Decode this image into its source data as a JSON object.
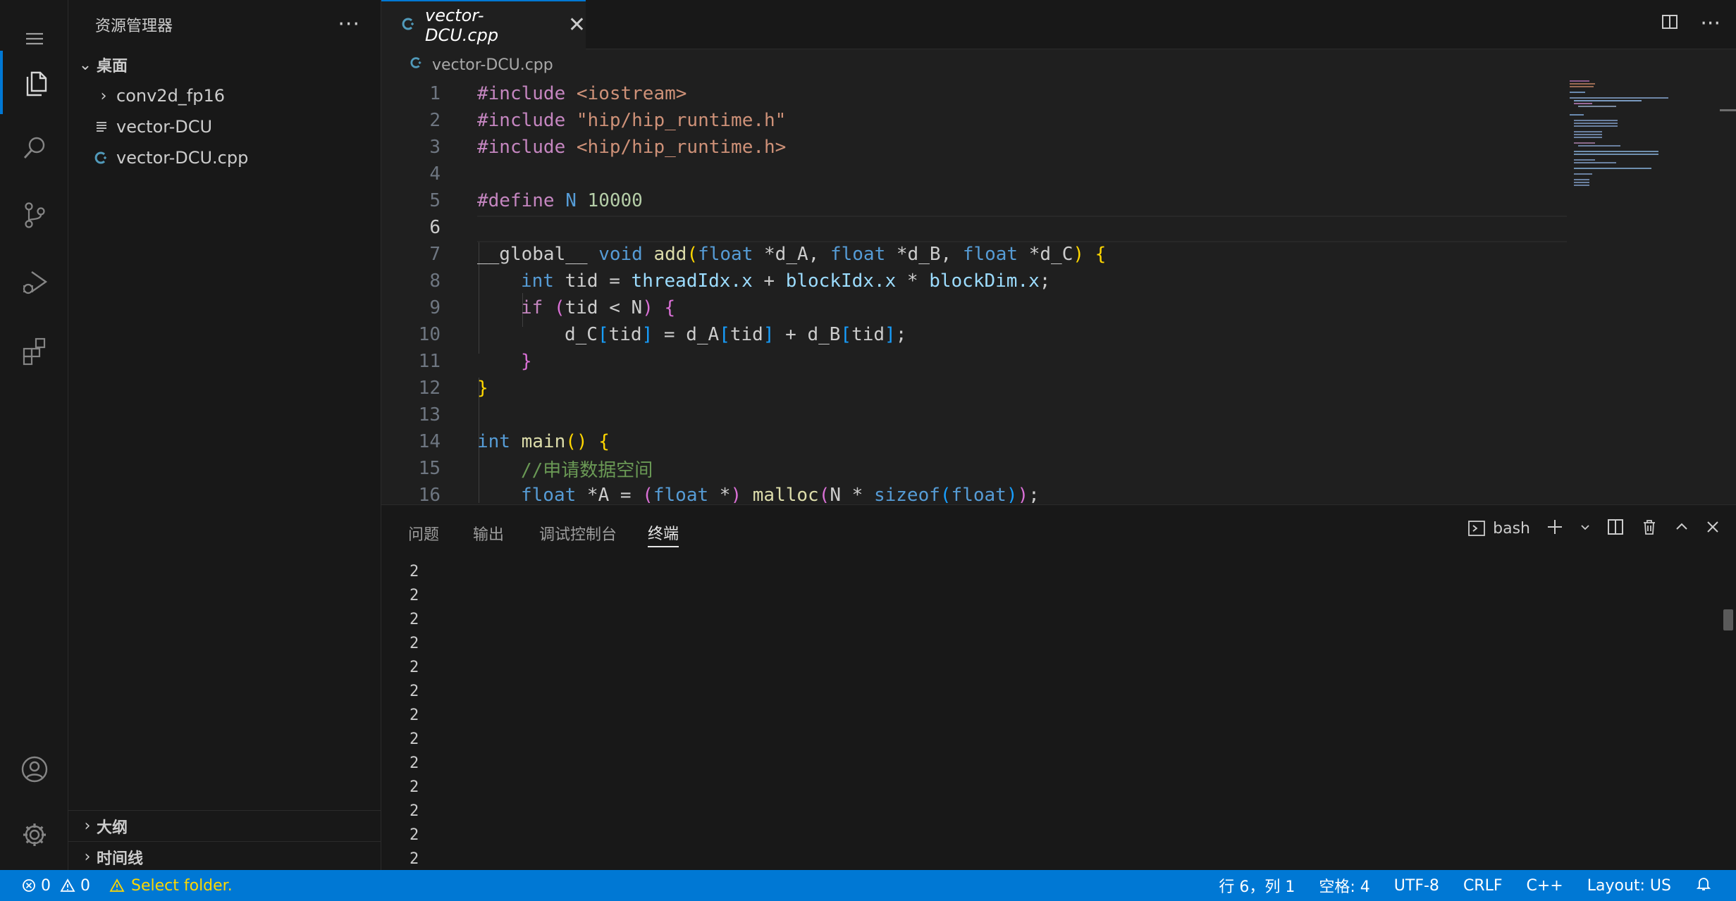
{
  "explorer": {
    "title": "资源管理器",
    "more_label": "···",
    "folder_name": "桌面",
    "items": [
      {
        "label": "conv2d_fp16",
        "kind": "folder"
      },
      {
        "label": "vector-DCU",
        "kind": "file"
      },
      {
        "label": "vector-DCU.cpp",
        "kind": "cpp"
      }
    ],
    "outline_label": "大纲",
    "timeline_label": "时间线"
  },
  "editor": {
    "tab_label": "vector-DCU.cpp",
    "tab_close": "✕",
    "breadcrumb": "vector-DCU.cpp",
    "current_line": 6,
    "lines": [
      {
        "n": "1"
      },
      {
        "n": "2"
      },
      {
        "n": "3"
      },
      {
        "n": "4"
      },
      {
        "n": "5"
      },
      {
        "n": "6"
      },
      {
        "n": "7"
      },
      {
        "n": "8"
      },
      {
        "n": "9"
      },
      {
        "n": "10"
      },
      {
        "n": "11"
      },
      {
        "n": "12"
      },
      {
        "n": "13"
      },
      {
        "n": "14"
      },
      {
        "n": "15"
      },
      {
        "n": "16"
      }
    ],
    "code": {
      "l1_a": "#include",
      "l1_b": " <iostream>",
      "l2_a": "#include",
      "l2_b": " \"hip/hip_runtime.h\"",
      "l3_a": "#include",
      "l3_b": " <hip/hip_runtime.h>",
      "l5_a": "#define",
      "l5_b": " N",
      "l5_c": " 10000",
      "l7_a": "__global__ ",
      "l7_b": "void",
      "l7_c": " add",
      "l7_d": "(",
      "l7_e": "float",
      "l7_f": " *d_A, ",
      "l7_g": "float",
      "l7_h": " *d_B, ",
      "l7_i": "float",
      "l7_j": " *d_C",
      "l7_k": ")",
      "l7_l": " {",
      "l8_a": "int",
      "l8_b": " tid = ",
      "l8_c": "threadIdx.x",
      "l8_d": " + ",
      "l8_e": "blockIdx.x",
      "l8_f": " * ",
      "l8_g": "blockDim.x",
      "l8_h": ";",
      "l9_a": "if",
      "l9_b": " (",
      "l9_c": "tid < N",
      "l9_d": ")",
      "l9_e": " {",
      "l10_a": "d_C",
      "l10_b": "[",
      "l10_c": "tid",
      "l10_d": "]",
      "l10_e": " = ",
      "l10_f": "d_A",
      "l10_g": "[",
      "l10_h": "tid",
      "l10_i": "]",
      "l10_j": " + ",
      "l10_k": "d_B",
      "l10_l": "[",
      "l10_m": "tid",
      "l10_n": "]",
      "l10_o": ";",
      "l11_a": "}",
      "l12_a": "}",
      "l14_a": "int",
      "l14_b": " main",
      "l14_c": "()",
      "l14_d": " {",
      "l15_a": "//申请数据空间",
      "l16_a": "float",
      "l16_b": " *A = ",
      "l16_c": "(",
      "l16_d": "float",
      "l16_e": " *",
      "l16_f": ")",
      "l16_g": " malloc",
      "l16_h": "(",
      "l16_i": "N * ",
      "l16_j": "sizeof",
      "l16_k": "(",
      "l16_l": "float",
      "l16_m": ")",
      "l16_n": ")",
      "l16_o": ";"
    }
  },
  "panel": {
    "tabs": [
      "问题",
      "输出",
      "调试控制台",
      "终端"
    ],
    "active_tab": "终端",
    "shell_label": "bash",
    "terminal_lines": [
      "2",
      "2",
      "2",
      "2",
      "2",
      "2",
      "2",
      "2",
      "2",
      "2",
      "2",
      "2",
      "2"
    ]
  },
  "statusbar": {
    "errors": "0",
    "warnings": "0",
    "message": "Select folder.",
    "position": "行 6，列 1",
    "spaces": "空格: 4",
    "encoding": "UTF-8",
    "eol": "CRLF",
    "language": "C++",
    "layout": "Layout: US"
  },
  "colors": {
    "accent": "#0078d4",
    "editor_bg": "#1f1f1f",
    "sidebar_bg": "#181818",
    "warning": "#cca700"
  }
}
